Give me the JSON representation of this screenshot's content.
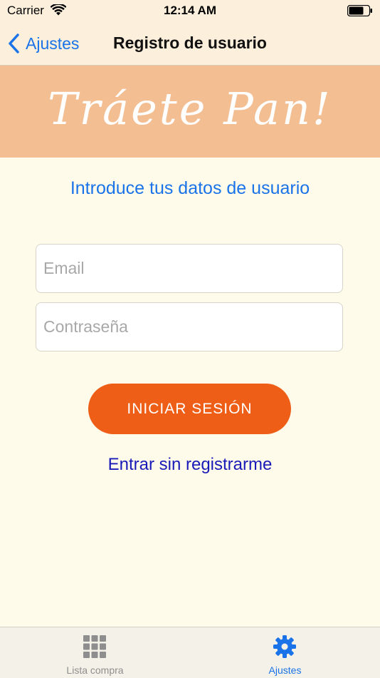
{
  "status_bar": {
    "carrier": "Carrier",
    "time": "12:14 AM"
  },
  "nav": {
    "back_label": "Ajustes",
    "title": "Registro de usuario"
  },
  "banner": {
    "logo_text": "Tráete Pan!"
  },
  "form": {
    "subtitle": "Introduce tus datos de usuario",
    "email_placeholder": "Email",
    "email_value": "",
    "password_placeholder": "Contraseña",
    "password_value": "",
    "login_label": "INICIAR SESIÓN",
    "guest_label": "Entrar sin registrarme"
  },
  "tabs": [
    {
      "label": "Lista compra",
      "icon": "grid-icon",
      "selected": false
    },
    {
      "label": "Ajustes",
      "icon": "gear-icon",
      "selected": true
    }
  ],
  "colors": {
    "accent": "#1A73E8",
    "banner": "#F4BE93",
    "button": "#EE5E16",
    "background": "#FEFBEA",
    "nav_background": "#FCEFDC"
  }
}
